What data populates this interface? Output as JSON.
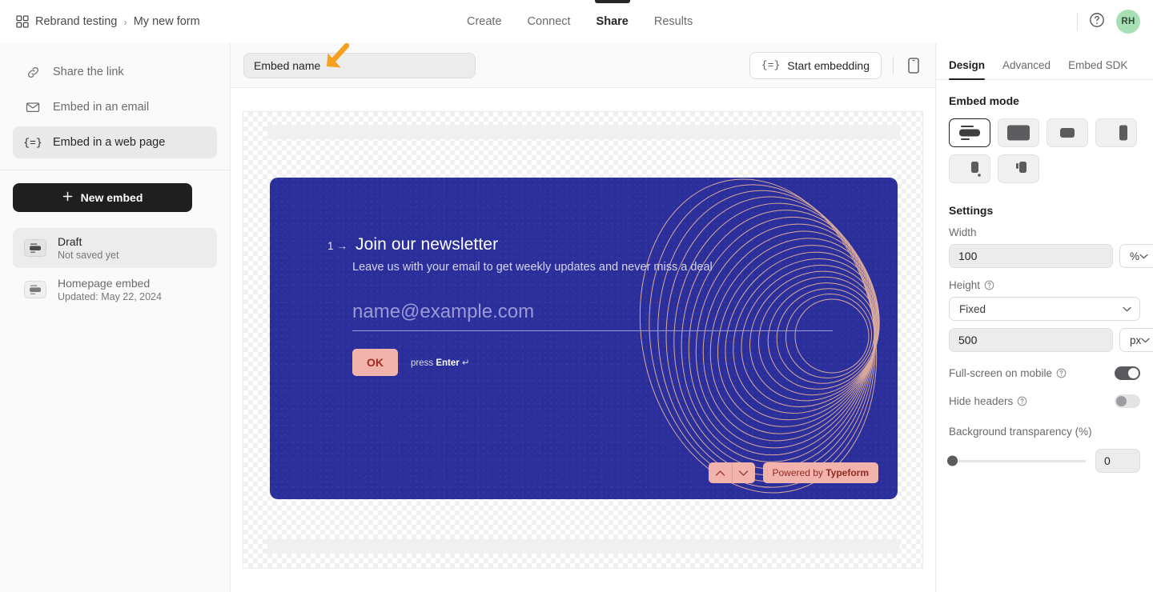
{
  "topbar": {
    "grid_icon": "grid-icon",
    "breadcrumb": {
      "workspace": "Rebrand testing",
      "separator": "›",
      "form": "My new form"
    },
    "tabs": [
      {
        "label": "Create",
        "active": false
      },
      {
        "label": "Connect",
        "active": false
      },
      {
        "label": "Share",
        "active": true
      },
      {
        "label": "Results",
        "active": false
      }
    ],
    "help_icon": "question-circle-icon",
    "avatar_initials": "RH",
    "avatar_color": "#a8e0b5"
  },
  "sidebar": {
    "items": [
      {
        "label": "Share the link",
        "icon": "link-icon",
        "selected": false
      },
      {
        "label": "Embed in an email",
        "icon": "envelope-icon",
        "selected": false
      },
      {
        "label": "Embed in a web page",
        "icon": "embed-code-icon",
        "selected": true
      }
    ],
    "new_embed_label": "New embed",
    "new_embed_icon": "plus-icon",
    "embeds": [
      {
        "title": "Draft",
        "subtitle": "Not saved yet",
        "selected": true
      },
      {
        "title": "Homepage embed",
        "subtitle": "Updated: May 22, 2024",
        "selected": false
      }
    ]
  },
  "toolbar": {
    "embed_name_value": "Embed name",
    "embed_name_placeholder": "Embed name",
    "start_embedding_label": "Start embedding",
    "start_embedding_icon": "embed-code-icon",
    "device_icon": "mobile-device-icon",
    "annotation_arrow": "arrow-down-left-icon",
    "annotation_color": "#f5a01e"
  },
  "preview": {
    "background": "transparency-checkerboard",
    "form": {
      "background_color": "#2b2f9c",
      "accent_color": "#f2b3ac",
      "question_number": "1",
      "question_arrow": "→",
      "title": "Join our newsletter",
      "description": "Leave us with your email to get weekly updates and never miss a deal",
      "answer_placeholder": "name@example.com",
      "ok_label": "OK",
      "press_enter_prefix": "press ",
      "press_enter_key": "Enter",
      "press_enter_symbol": "↵",
      "nav_up_icon": "chevron-up-icon",
      "nav_down_icon": "chevron-down-icon",
      "powered_prefix": "Powered by ",
      "powered_brand": "Typeform"
    }
  },
  "rightpanel": {
    "tabs": [
      {
        "label": "Design",
        "active": true
      },
      {
        "label": "Advanced",
        "active": false
      },
      {
        "label": "Embed SDK",
        "active": false
      }
    ],
    "embed_mode_heading": "Embed mode",
    "embed_modes": [
      {
        "name": "inline-embed",
        "selected": true
      },
      {
        "name": "fullpage-embed",
        "selected": false
      },
      {
        "name": "popup-embed",
        "selected": false
      },
      {
        "name": "slider-embed",
        "selected": false
      },
      {
        "name": "popover-embed",
        "selected": false
      },
      {
        "name": "side-tab-embed",
        "selected": false
      }
    ],
    "settings_heading": "Settings",
    "width_label": "Width",
    "width_value": "100",
    "width_unit": "%",
    "height_label": "Height",
    "height_mode": "Fixed",
    "height_value": "500",
    "height_unit": "px",
    "fullscreen_label": "Full-screen on mobile",
    "fullscreen_on": true,
    "hide_headers_label": "Hide headers",
    "hide_headers_on": false,
    "bg_transparency_label": "Background transparency (%)",
    "bg_transparency_value": "0",
    "help_icon": "question-circle-icon",
    "chevron_icon": "chevron-down-icon"
  }
}
